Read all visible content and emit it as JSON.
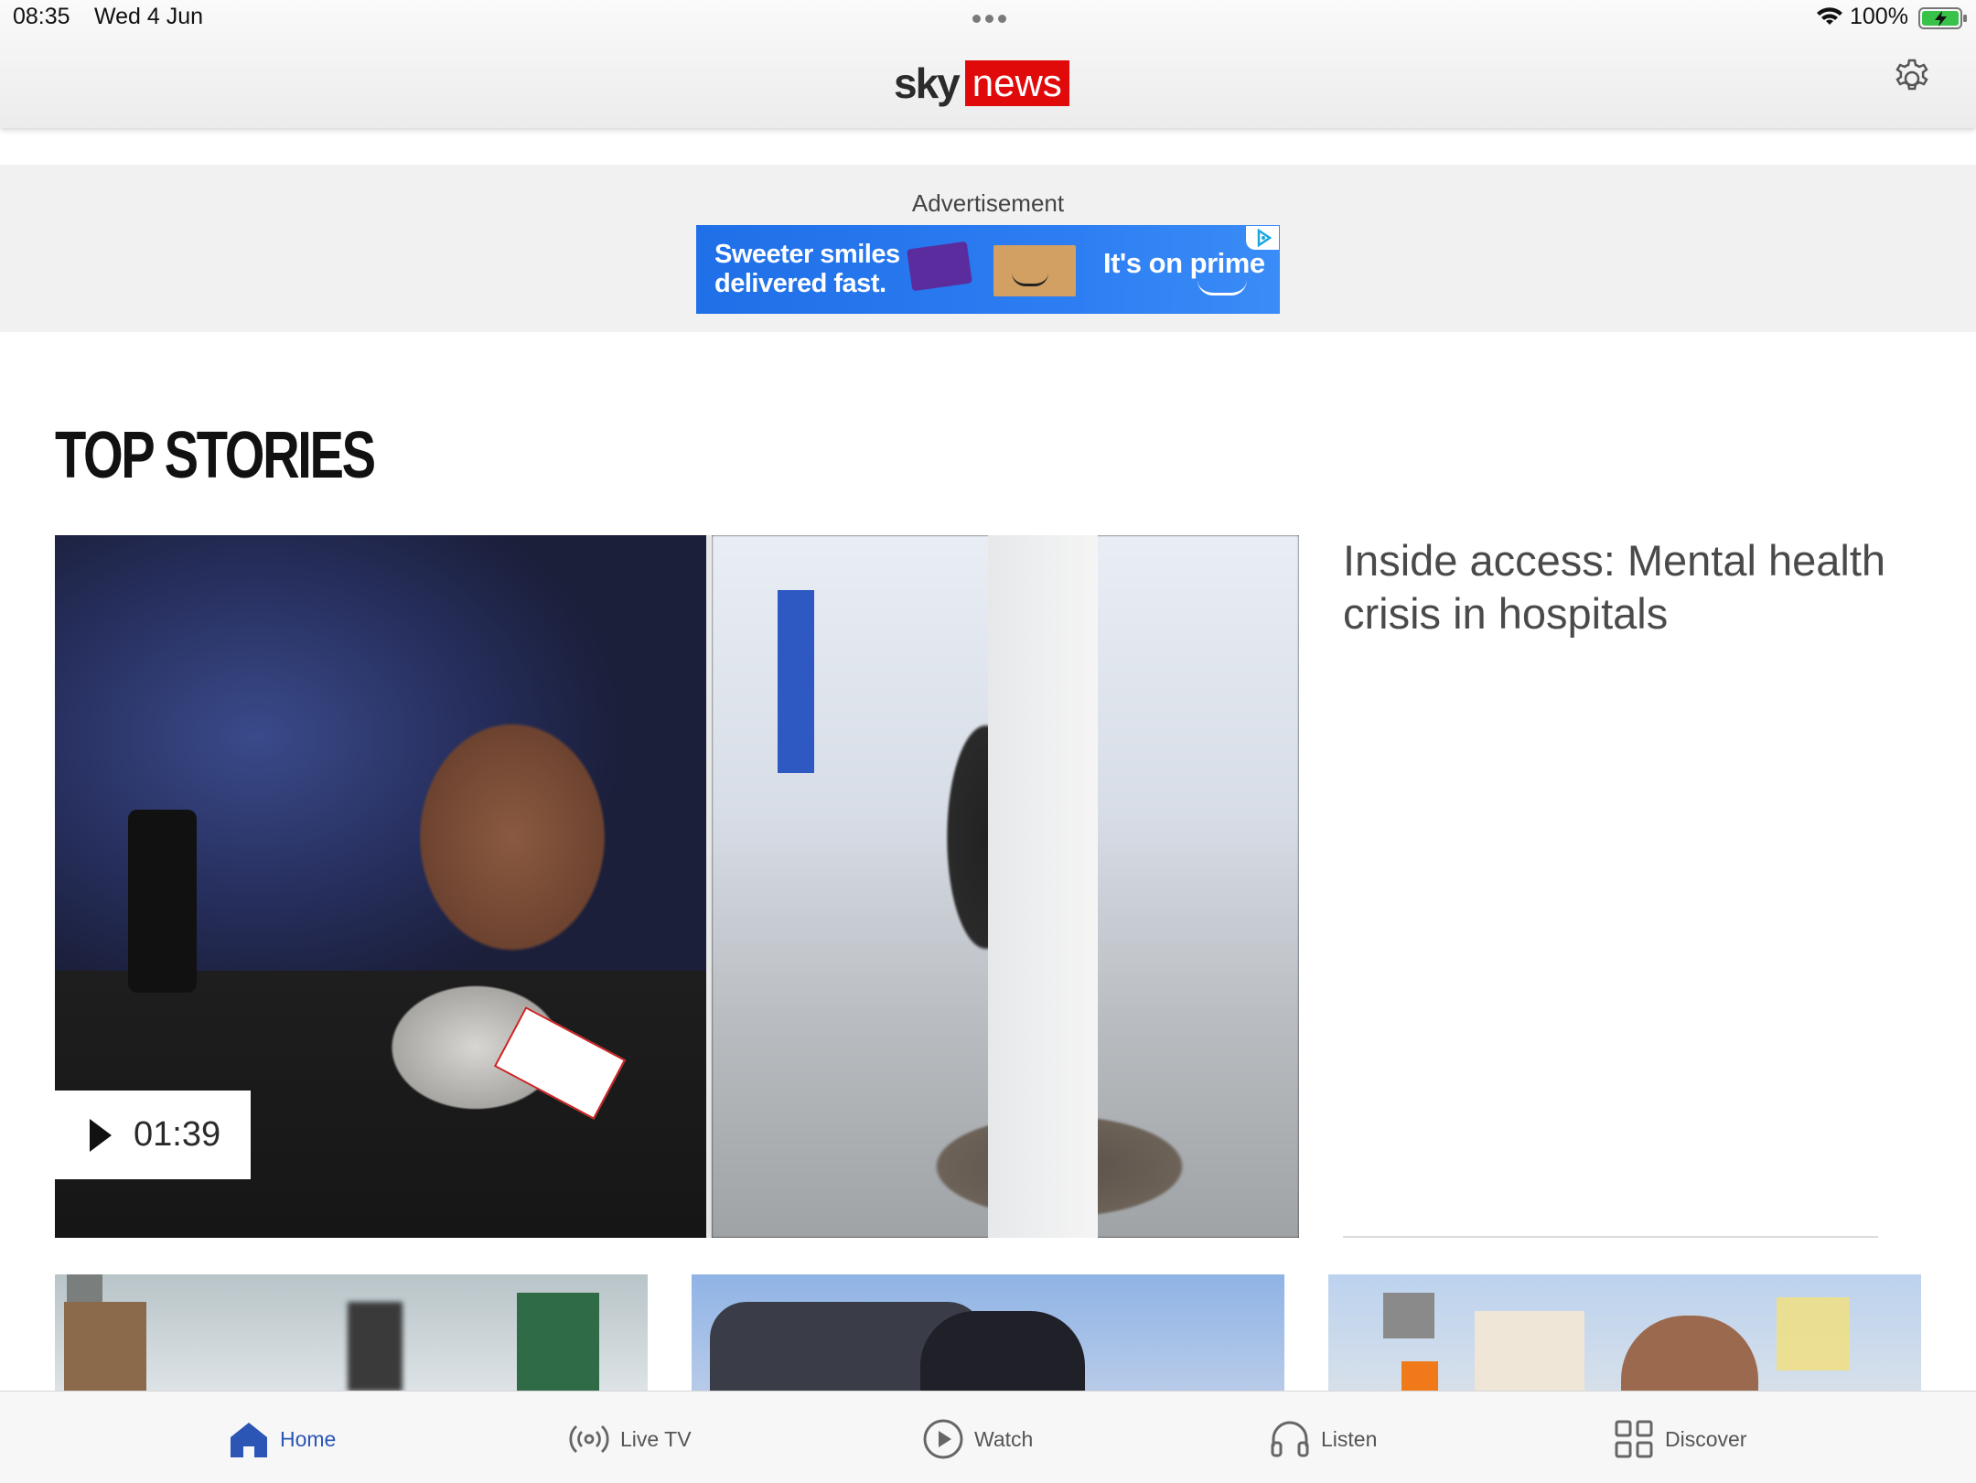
{
  "status_bar": {
    "time": "08:35",
    "date": "Wed 4 Jun",
    "battery": "100%"
  },
  "header": {
    "logo_sky": "sky",
    "logo_news": "news"
  },
  "advertisement": {
    "label": "Advertisement",
    "headline_line1": "Sweeter smiles",
    "headline_line2": "delivered fast.",
    "tagline": "It's on prime"
  },
  "top_stories": {
    "title": "TOP STORIES",
    "lead_story": {
      "headline": "Inside access: Mental health crisis in hospitals",
      "duration": "01:39"
    }
  },
  "tab_bar": {
    "items": [
      {
        "label": "Home",
        "icon": "home-icon",
        "active": true
      },
      {
        "label": "Live TV",
        "icon": "broadcast-icon",
        "active": false
      },
      {
        "label": "Watch",
        "icon": "play-circle-icon",
        "active": false
      },
      {
        "label": "Listen",
        "icon": "headphones-icon",
        "active": false
      },
      {
        "label": "Discover",
        "icon": "grid-icon",
        "active": false
      }
    ]
  },
  "colors": {
    "brand_red": "#e10a0a",
    "active_tab": "#2b56b6",
    "ad_blue": "#2c7cf2"
  }
}
